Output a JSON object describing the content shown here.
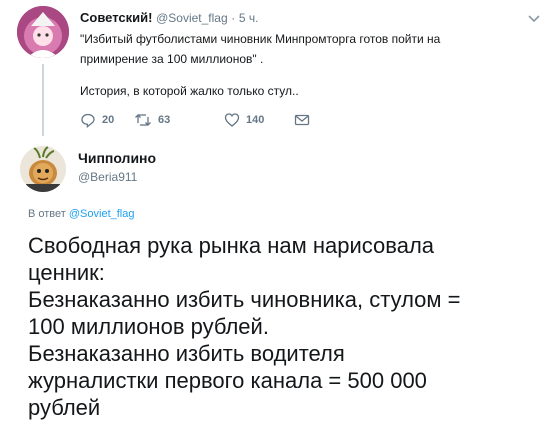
{
  "parent_tweet": {
    "author_name": "Советский!",
    "handle": "@Soviet_flag",
    "separator": "·",
    "time": "5 ч.",
    "text_lines": [
      "\"Избитый футболистами чиновник Минпромторга готов пойти на",
      "примирение за 100 миллионов\" ."
    ],
    "text_lines_2": [
      "История, в которой жалко только стул.."
    ],
    "actions": {
      "reply_count": "20",
      "retweet_count": "63",
      "like_count": "140"
    },
    "icons": {
      "menu": "chevron-down-icon",
      "reply": "reply-icon",
      "retweet": "retweet-icon",
      "like": "heart-icon",
      "dm": "envelope-icon"
    }
  },
  "reply_tweet": {
    "author_name": "Чипполино",
    "handle": "@Beria911",
    "reply_prefix": "В ответ",
    "reply_to": "@Soviet_flag",
    "text_lines": [
      "Свободная рука рынка нам нарисовала",
      "ценник:",
      "Безнаказанно избить чиновника, стулом =",
      "100 миллионов рублей.",
      "Безнаказанно избить водителя",
      "журналистки первого канала = 500 000",
      "рублей"
    ]
  },
  "colors": {
    "text": "#14171a",
    "muted": "#657786",
    "link": "#1da1f2",
    "thread_line": "#ccd6dd"
  }
}
